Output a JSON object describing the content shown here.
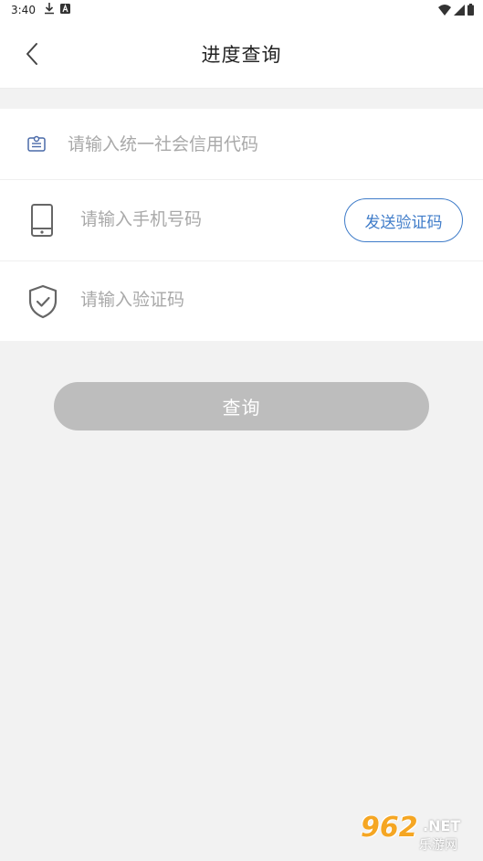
{
  "status_bar": {
    "time": "3:40",
    "download_icon": "download-icon",
    "a_icon": "a-badge-icon",
    "wifi_icon": "wifi-icon",
    "signal_icon": "signal-icon",
    "battery_icon": "battery-icon"
  },
  "header": {
    "title": "进度查询",
    "back_icon": "back-chevron-icon"
  },
  "form": {
    "credit_code": {
      "icon": "id-card-icon",
      "placeholder": "请输入统一社会信用代码",
      "value": ""
    },
    "phone": {
      "icon": "phone-icon",
      "placeholder": "请输入手机号码",
      "value": "",
      "send_code_label": "发送验证码"
    },
    "verify_code": {
      "icon": "shield-check-icon",
      "placeholder": "请输入验证码",
      "value": ""
    }
  },
  "query_button": {
    "label": "查询"
  },
  "watermark": {
    "number": "962",
    "suffix": ".NET",
    "site_name": "乐游网"
  },
  "colors": {
    "accent": "#3f7cc9",
    "disabled_button": "#bdbdbd",
    "background": "#f2f2f2",
    "placeholder": "#a9a9a9",
    "icon_gray": "#666666"
  }
}
